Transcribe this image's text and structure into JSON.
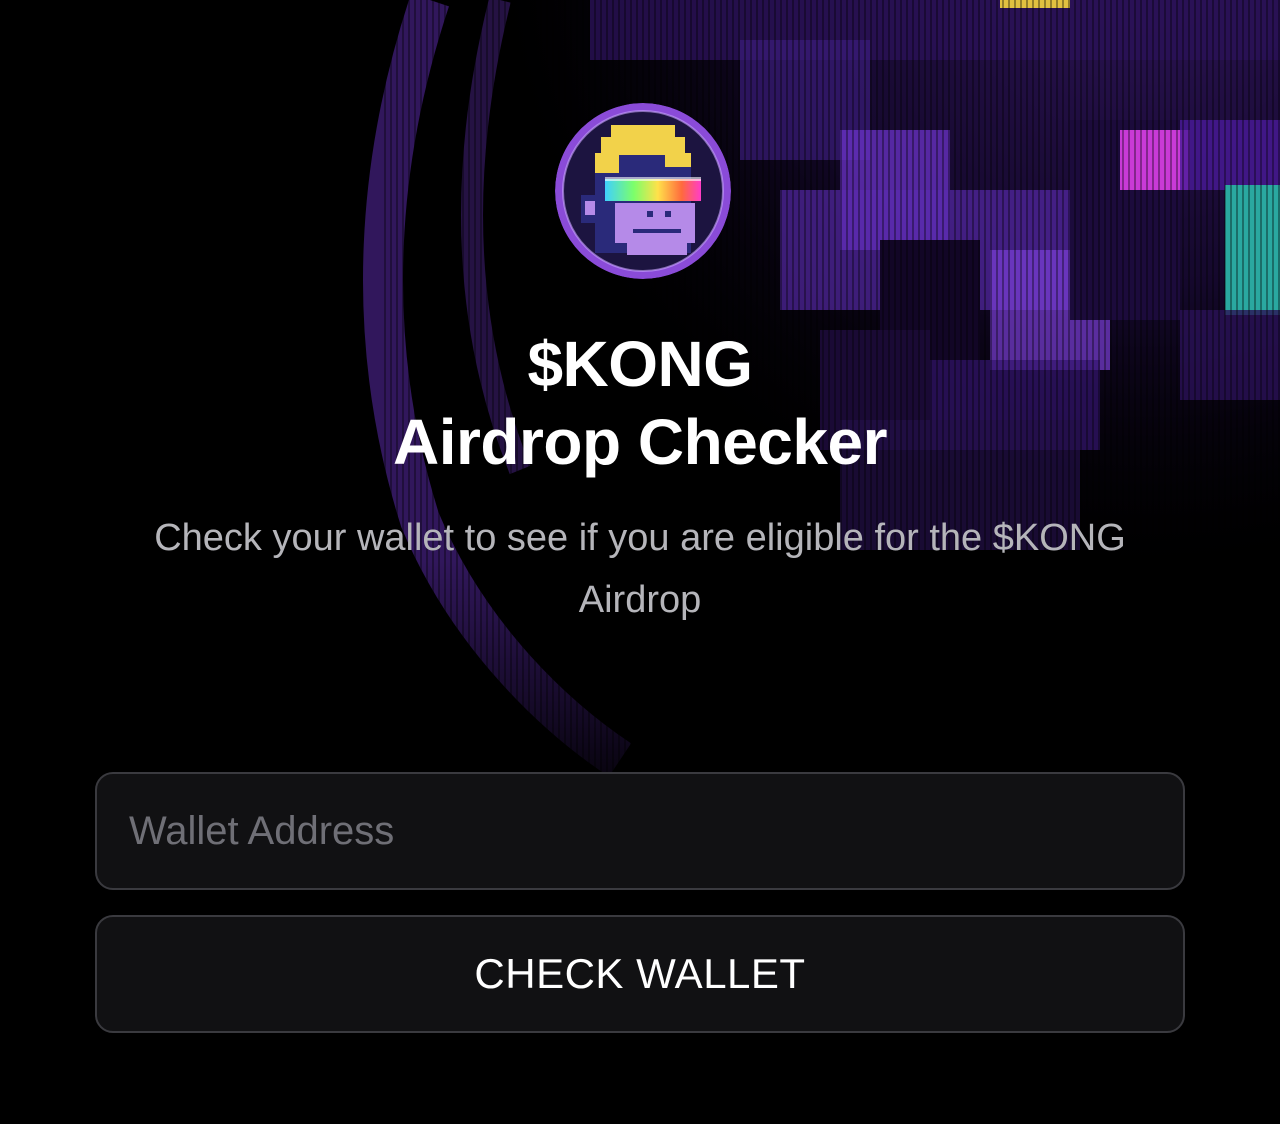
{
  "hero": {
    "logo_icon": "pixel-ape-logo-icon",
    "title_line1": "$KONG",
    "title_line2": "Airdrop Checker",
    "subtitle": "Check your wallet to see if you are eligible for the $KONG Airdrop"
  },
  "form": {
    "wallet_placeholder": "Wallet Address",
    "wallet_value": "",
    "check_button_label": "CHECK WALLET"
  },
  "colors": {
    "background": "#000000",
    "accent_purple": "#7a3fd6",
    "accent_magenta": "#c93ad6",
    "accent_teal": "#2aa8a0",
    "field_background": "#111113",
    "field_border": "#3a3a3f"
  }
}
